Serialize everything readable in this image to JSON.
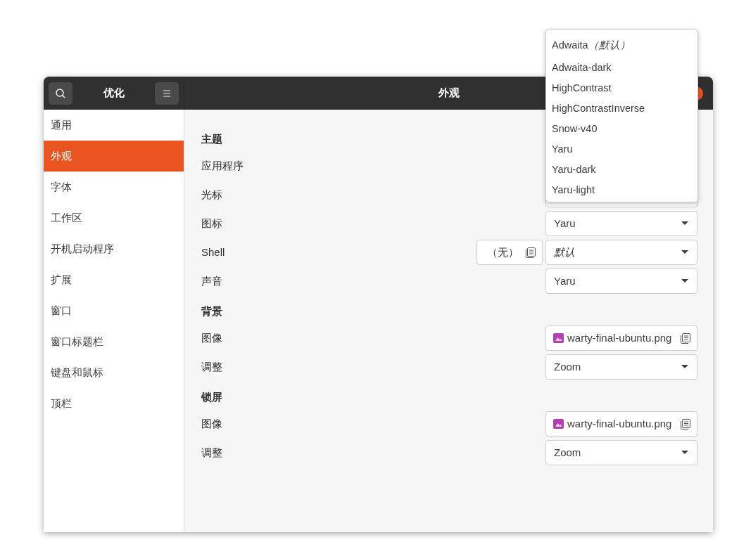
{
  "header": {
    "app_title": "优化",
    "title": "外观"
  },
  "nav": [
    {
      "label": "通用",
      "selected": false
    },
    {
      "label": "外观",
      "selected": true
    },
    {
      "label": "字体",
      "selected": false
    },
    {
      "label": "工作区",
      "selected": false
    },
    {
      "label": "开机启动程序",
      "selected": false
    },
    {
      "label": "扩展",
      "selected": false
    },
    {
      "label": "窗口",
      "selected": false
    },
    {
      "label": "窗口标题栏",
      "selected": false
    },
    {
      "label": "键盘和鼠标",
      "selected": false
    },
    {
      "label": "顶栏",
      "selected": false
    }
  ],
  "sections": [
    {
      "heading": "主题",
      "rows": [
        {
          "label": "应用程序",
          "kind": "dropdown"
        },
        {
          "label": "光标",
          "kind": "dropdown"
        },
        {
          "label": "图标",
          "kind": "dropdown",
          "value": "Yaru",
          "is_default": false
        },
        {
          "label": "Shell",
          "kind": "shell",
          "file_value": "（无）",
          "value": "默认",
          "is_default": true
        },
        {
          "label": "声音",
          "kind": "dropdown",
          "value": "Yaru",
          "is_default": false
        }
      ]
    },
    {
      "heading": "背景",
      "rows": [
        {
          "label": "图像",
          "kind": "file",
          "value": "warty-final-ubuntu.png"
        },
        {
          "label": "调整",
          "kind": "dropdown",
          "value": "Zoom",
          "is_default": false
        }
      ]
    },
    {
      "heading": "锁屏",
      "rows": [
        {
          "label": "图像",
          "kind": "file",
          "value": "warty-final-ubuntu.png"
        },
        {
          "label": "调整",
          "kind": "dropdown",
          "value": "Zoom",
          "is_default": false
        }
      ]
    }
  ],
  "popup": {
    "items": [
      {
        "label": "Adwaita",
        "note": "（默认）"
      },
      {
        "label": "Adwaita-dark"
      },
      {
        "label": "HighContrast"
      },
      {
        "label": "HighContrastInverse"
      },
      {
        "label": "Snow-v40"
      },
      {
        "label": "Yaru"
      },
      {
        "label": "Yaru-dark"
      },
      {
        "label": "Yaru-light"
      }
    ]
  }
}
